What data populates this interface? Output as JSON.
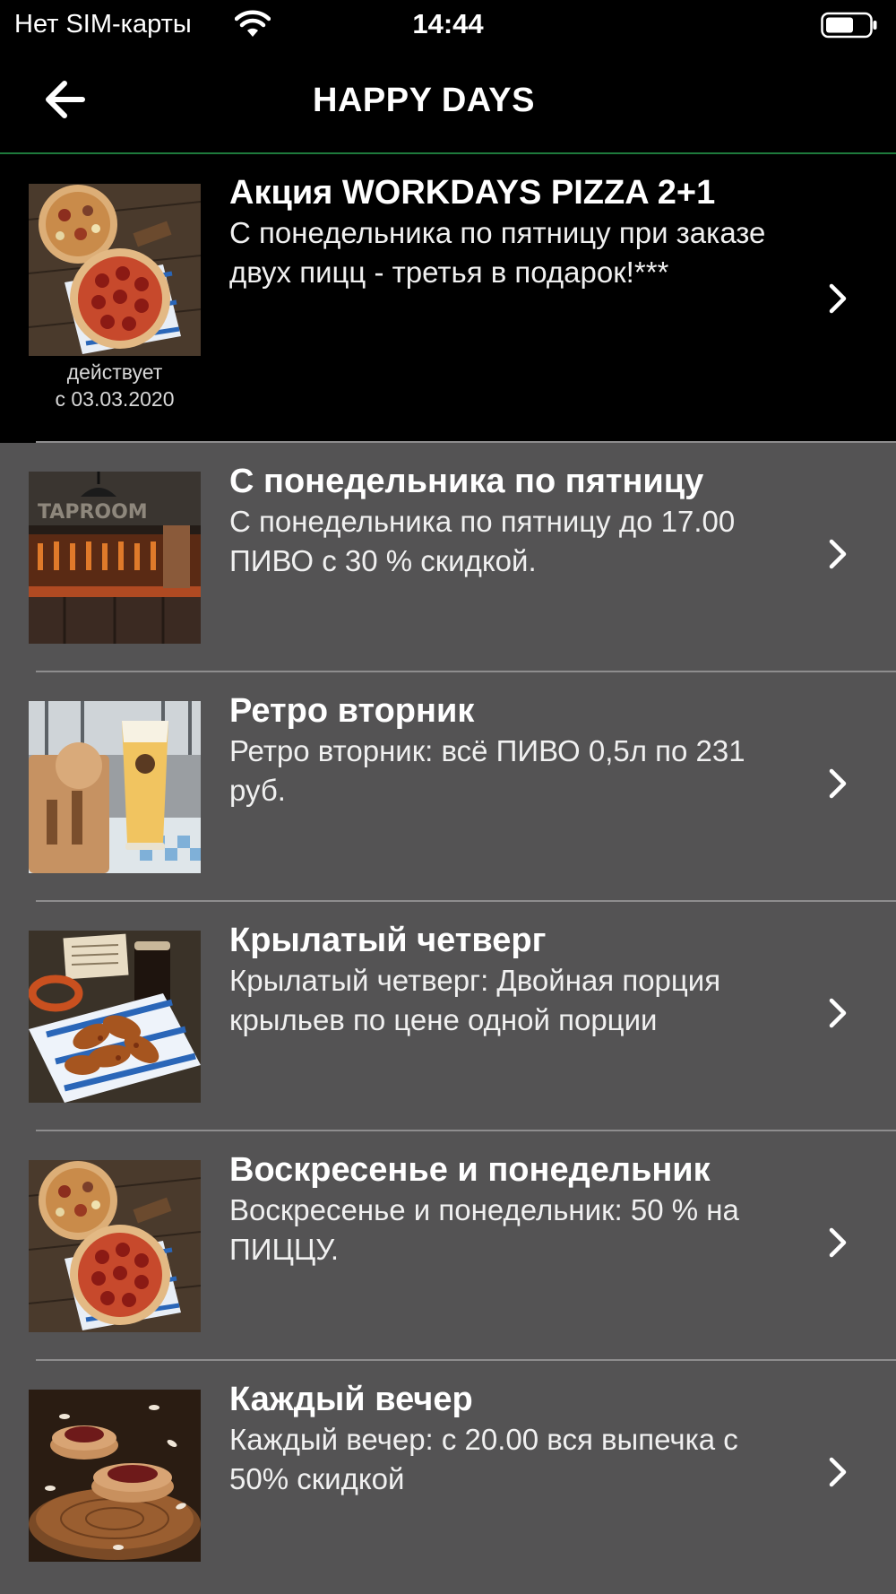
{
  "status_bar": {
    "carrier": "Нет SIM-карты",
    "time": "14:44"
  },
  "nav": {
    "title": "HAPPY DAYS",
    "back_icon": "back-arrow-icon"
  },
  "promos": [
    {
      "title": "Акция WORKDAYS PIZZA 2+1",
      "description": "С понедельника по пятницу при заказе двух пицц - третья в подарок!***",
      "validity_line1": "действует",
      "validity_line2": "с 03.03.2020",
      "image": "pizza"
    },
    {
      "title": "С понедельника по пятницу",
      "description": "С понедельника по пятницу до 17.00 ПИВО с 30 % скидкой.",
      "image": "bar"
    },
    {
      "title": "Ретро вторник",
      "description": "Ретро вторник: всё ПИВО 0,5л по 231 руб.",
      "image": "beer"
    },
    {
      "title": "Крылатый четверг",
      "description": "Крылатый четверг: Двойная порция крыльев по цене одной порции",
      "image": "wings"
    },
    {
      "title": "Воскресенье и понедельник",
      "description": "Воскресенье и понедельник: 50 % на ПИЦЦУ.",
      "image": "pizza"
    },
    {
      "title": "Каждый вечер",
      "description": "Каждый вечер: с 20.00 вся выпечка с 50% скидкой",
      "image": "pastry"
    }
  ],
  "colors": {
    "featured_bg": "#000000",
    "list_bg": "#545354",
    "accent_line": "#1e7a3c"
  }
}
